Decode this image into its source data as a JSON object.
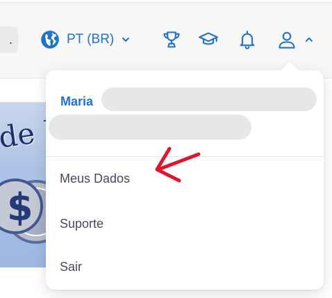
{
  "header": {
    "search_partial_text": ".",
    "language": {
      "label": "PT (BR)"
    },
    "icons": {
      "globe": "globe-icon",
      "language_chevron": "chevron-down-icon",
      "trophy": "trophy-icon",
      "graduation": "graduation-cap-icon",
      "notifications": "bell-icon",
      "user": "user-icon",
      "user_chevron": "chevron-up-icon"
    }
  },
  "banner": {
    "visible_text": "de D"
  },
  "user_menu": {
    "name_visible": "Maria",
    "items": [
      {
        "label": "Meus Dados"
      },
      {
        "label": "Suporte"
      },
      {
        "label": "Sair"
      }
    ]
  },
  "colors": {
    "accent": "#1f74c9",
    "menu_text": "#454b5c",
    "annotation_arrow": "#e0142c"
  }
}
